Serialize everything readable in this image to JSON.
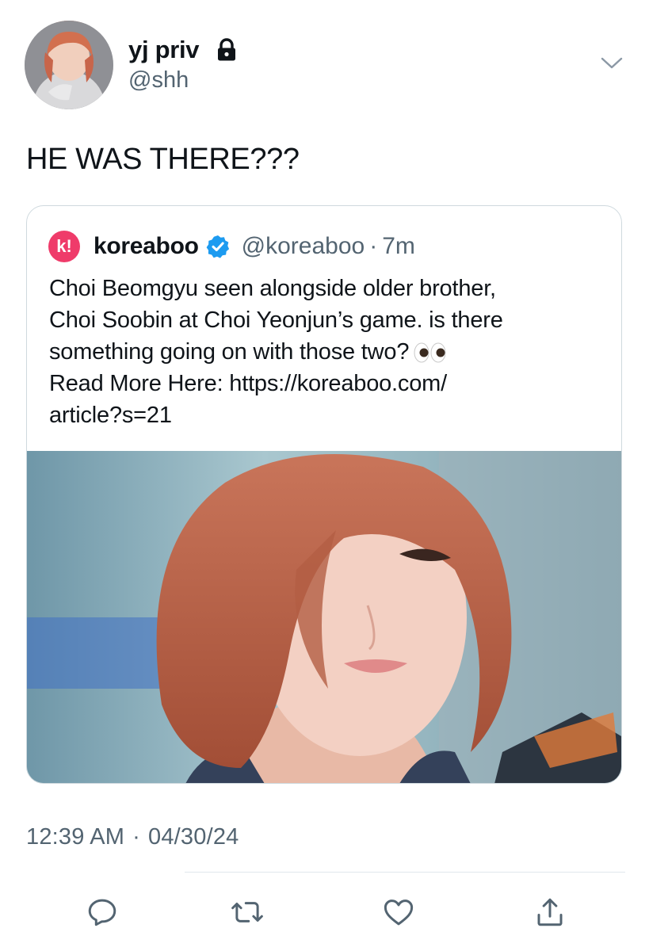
{
  "author": {
    "display_name": "yj priv",
    "handle": "@shh",
    "locked_icon": "lock-icon",
    "menu_icon": "chevron-down-icon"
  },
  "tweet": {
    "text": "HE WAS THERE???"
  },
  "quoted_tweet": {
    "logo_letter": "k!",
    "name": "koreaboo",
    "verified_icon": "verified-badge-icon",
    "handle": "@koreaboo",
    "separator": "·",
    "time": "7m",
    "lines": [
      "Choi Beomgyu seen alongside older brother,",
      "Choi Soobin at Choi Yeonjun’s game. is there",
      "something going on with those two?",
      "Read More Here: https://koreaboo.com/",
      "article?s=21"
    ],
    "emoji": "👀",
    "image_icon": "photo"
  },
  "meta": {
    "time": "12:39 AM",
    "separator": "·",
    "date": "04/30/24"
  },
  "actions": [
    {
      "name": "reply",
      "icon": "reply-icon"
    },
    {
      "name": "retweet",
      "icon": "retweet-icon"
    },
    {
      "name": "like",
      "icon": "heart-icon"
    },
    {
      "name": "share",
      "icon": "share-icon"
    }
  ],
  "colors": {
    "text": "#0f1419",
    "secondary": "#536471",
    "border": "#cfd9de",
    "verified": "#1d9bf0",
    "logo": "#ef3b6a"
  }
}
